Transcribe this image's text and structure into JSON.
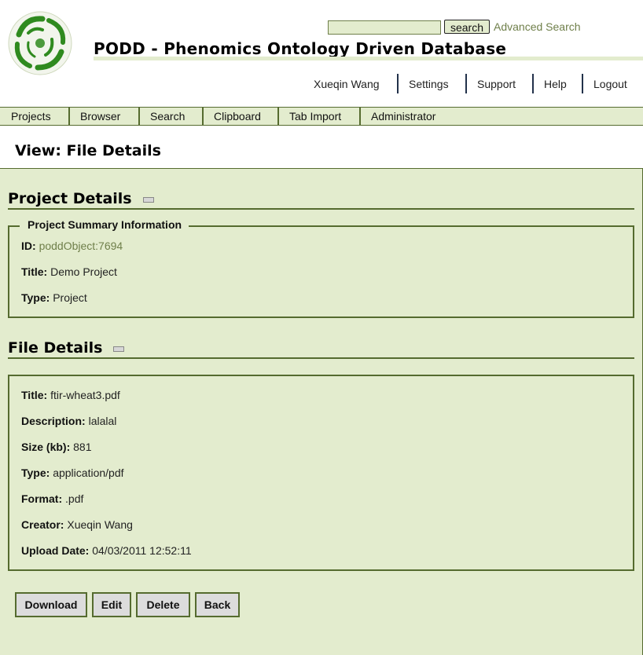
{
  "header": {
    "search_button": "search",
    "advanced_search": "Advanced Search",
    "app_title": "PODD - Phenomics Ontology Driven Database",
    "user_nav": [
      "Xueqin Wang",
      "Settings",
      "Support",
      "Help",
      "Logout"
    ]
  },
  "main_nav": [
    "Projects",
    "Browser",
    "Search",
    "Clipboard",
    "Tab Import",
    "Administrator"
  ],
  "page_title": "View: File Details",
  "project_details": {
    "heading": "Project Details",
    "legend": "Project Summary Information",
    "id_label": "ID:",
    "id_value": "poddObject:7694",
    "title_label": "Title:",
    "title_value": "Demo Project",
    "type_label": "Type:",
    "type_value": "Project"
  },
  "file_details": {
    "heading": "File Details",
    "title_label": "Title:",
    "title_value": "ftir-wheat3.pdf",
    "description_label": "Description:",
    "description_value": "lalalal",
    "size_label": "Size (kb):",
    "size_value": "881",
    "type_label": "Type:",
    "type_value": "application/pdf",
    "format_label": "Format:",
    "format_value": ".pdf",
    "creator_label": "Creator:",
    "creator_value": "Xueqin Wang",
    "upload_label": "Upload Date:",
    "upload_value": "04/03/2011 12:52:11"
  },
  "buttons": {
    "download": "Download",
    "edit": "Edit",
    "delete": "Delete",
    "back": "Back"
  },
  "colors": {
    "panel_bg": "#e3ecce",
    "border": "#556b2f",
    "link": "#6f7f4a",
    "logo_green": "#2f8a1f"
  }
}
